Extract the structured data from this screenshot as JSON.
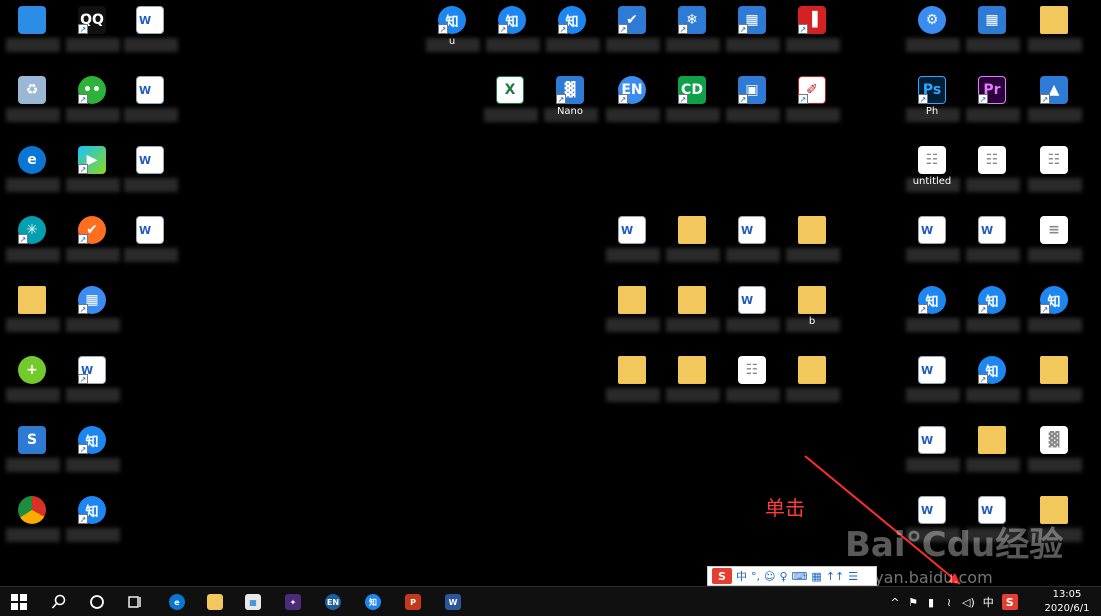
{
  "annotation": {
    "text": "单击"
  },
  "watermark": {
    "brand": "Bai℃du经验",
    "url": "jingyan.baidu.com"
  },
  "icons": [
    {
      "label": "",
      "kind": "computer",
      "glyph": "",
      "shortcut": false
    },
    {
      "label": "",
      "kind": "qq",
      "glyph": "QQ",
      "shortcut": true
    },
    {
      "label": "",
      "kind": "word",
      "glyph": "W",
      "shortcut": false
    },
    {
      "label": "",
      "kind": "recycle",
      "glyph": "♻",
      "shortcut": false
    },
    {
      "label": "",
      "kind": "wechat",
      "glyph": "••",
      "shortcut": true
    },
    {
      "label": "",
      "kind": "word",
      "glyph": "W",
      "shortcut": false
    },
    {
      "label": "",
      "kind": "edge",
      "glyph": "e",
      "shortcut": false
    },
    {
      "label": "",
      "kind": "video",
      "glyph": "▶",
      "shortcut": true
    },
    {
      "label": "",
      "kind": "word",
      "glyph": "W",
      "shortcut": false
    },
    {
      "label": "",
      "kind": "teal",
      "glyph": "✳",
      "shortcut": true
    },
    {
      "label": "",
      "kind": "orange",
      "glyph": "✔",
      "shortcut": true
    },
    {
      "label": "",
      "kind": "word",
      "glyph": "W",
      "shortcut": false
    },
    {
      "label": "",
      "kind": "folder",
      "glyph": "",
      "shortcut": false
    },
    {
      "label": "",
      "kind": "blue2",
      "glyph": "▦",
      "shortcut": true
    },
    {
      "label": "",
      "kind": "yellowgreen",
      "glyph": "+",
      "shortcut": false
    },
    {
      "label": "",
      "kind": "word",
      "glyph": "W",
      "shortcut": true
    },
    {
      "label": "",
      "kind": "generic",
      "glyph": "S",
      "shortcut": false
    },
    {
      "label": "",
      "kind": "zhi",
      "glyph": "知",
      "shortcut": true
    },
    {
      "label": "",
      "kind": "chrome",
      "glyph": "",
      "shortcut": false
    },
    {
      "label": "",
      "kind": "zhi",
      "glyph": "知",
      "shortcut": true
    },
    {
      "label": "u",
      "kind": "zhi",
      "glyph": "知",
      "shortcut": true
    },
    {
      "label": "",
      "kind": "zhi",
      "glyph": "知",
      "shortcut": true
    },
    {
      "label": "",
      "kind": "zhi",
      "glyph": "知",
      "shortcut": true
    },
    {
      "label": "",
      "kind": "generic",
      "glyph": "✔",
      "shortcut": true
    },
    {
      "label": "",
      "kind": "generic",
      "glyph": "❄",
      "shortcut": true
    },
    {
      "label": "",
      "kind": "generic",
      "glyph": "▦",
      "shortcut": true
    },
    {
      "label": "",
      "kind": "red",
      "glyph": "▐",
      "shortcut": true
    },
    {
      "label": "",
      "kind": "excel",
      "glyph": "X",
      "shortcut": false
    },
    {
      "label": "Nano",
      "kind": "generic",
      "glyph": "▓",
      "shortcut": true
    },
    {
      "label": "",
      "kind": "blue2",
      "glyph": "EN",
      "shortcut": true
    },
    {
      "label": "",
      "kind": "green",
      "glyph": "CD",
      "shortcut": true
    },
    {
      "label": "",
      "kind": "generic",
      "glyph": "▣",
      "shortcut": true
    },
    {
      "label": "",
      "kind": "pdf",
      "glyph": "✐",
      "shortcut": true
    },
    {
      "label": "",
      "kind": "blue2",
      "glyph": "⚙",
      "shortcut": false
    },
    {
      "label": "",
      "kind": "generic",
      "glyph": "▦",
      "shortcut": false
    },
    {
      "label": "",
      "kind": "folder",
      "glyph": "",
      "shortcut": false
    },
    {
      "label": "Ph",
      "kind": "ps",
      "glyph": "Ps",
      "shortcut": true
    },
    {
      "label": "",
      "kind": "pr",
      "glyph": "Pr",
      "shortcut": true
    },
    {
      "label": "",
      "kind": "generic",
      "glyph": "▲",
      "shortcut": true
    },
    {
      "label": "untitled",
      "kind": "doc",
      "glyph": "☷",
      "shortcut": false
    },
    {
      "label": "",
      "kind": "doc",
      "glyph": "☷",
      "shortcut": false
    },
    {
      "label": "",
      "kind": "doc",
      "glyph": "☷",
      "shortcut": false
    },
    {
      "label": "",
      "kind": "word",
      "glyph": "W",
      "shortcut": false
    },
    {
      "label": "",
      "kind": "word",
      "glyph": "W",
      "shortcut": false
    },
    {
      "label": "",
      "kind": "doc",
      "glyph": "≡",
      "shortcut": false
    },
    {
      "label": "",
      "kind": "zhi",
      "glyph": "知",
      "shortcut": true
    },
    {
      "label": "",
      "kind": "zhi",
      "glyph": "知",
      "shortcut": true
    },
    {
      "label": "",
      "kind": "zhi",
      "glyph": "知",
      "shortcut": true
    },
    {
      "label": "",
      "kind": "word",
      "glyph": "W",
      "shortcut": false
    },
    {
      "label": "",
      "kind": "zhi",
      "glyph": "知",
      "shortcut": true
    },
    {
      "label": "",
      "kind": "folder",
      "glyph": "",
      "shortcut": false
    },
    {
      "label": "",
      "kind": "word",
      "glyph": "W",
      "shortcut": false
    },
    {
      "label": "",
      "kind": "folder",
      "glyph": "",
      "shortcut": false
    },
    {
      "label": "",
      "kind": "doc",
      "glyph": "▓",
      "shortcut": false
    },
    {
      "label": "",
      "kind": "word",
      "glyph": "W",
      "shortcut": false
    },
    {
      "label": "",
      "kind": "word",
      "glyph": "W",
      "shortcut": false
    },
    {
      "label": "",
      "kind": "folder",
      "glyph": "",
      "shortcut": false
    },
    {
      "label": "",
      "kind": "word",
      "glyph": "W",
      "shortcut": false
    },
    {
      "label": "",
      "kind": "folder",
      "glyph": "",
      "shortcut": false
    },
    {
      "label": "",
      "kind": "word",
      "glyph": "W",
      "shortcut": false
    },
    {
      "label": "",
      "kind": "folder",
      "glyph": "",
      "shortcut": false
    },
    {
      "label": "",
      "kind": "folder",
      "glyph": "",
      "shortcut": false
    },
    {
      "label": "",
      "kind": "folder",
      "glyph": "",
      "shortcut": false
    },
    {
      "label": "",
      "kind": "word",
      "glyph": "W",
      "shortcut": false
    },
    {
      "label": "b",
      "kind": "folder",
      "glyph": "",
      "shortcut": false
    },
    {
      "label": "",
      "kind": "folder",
      "glyph": "",
      "shortcut": false
    },
    {
      "label": "",
      "kind": "folder",
      "glyph": "",
      "shortcut": false
    },
    {
      "label": "",
      "kind": "doc",
      "glyph": "☷",
      "shortcut": false
    },
    {
      "label": "",
      "kind": "folder",
      "glyph": "",
      "shortcut": false
    }
  ],
  "ime": {
    "logo": "S",
    "items": [
      "中",
      "°,",
      "☺",
      "♀",
      "⌨",
      "▦",
      "↑↑",
      "☰"
    ]
  },
  "taskbar": {
    "pinned": [
      {
        "name": "edge",
        "glyph": "e",
        "color": "#0a76d4"
      },
      {
        "name": "explorer",
        "glyph": "",
        "color": "#f2c75c"
      },
      {
        "name": "store",
        "glyph": "▦",
        "color": "#e8e8e8"
      },
      {
        "name": "app-purple",
        "glyph": "✦",
        "color": "#4b2c7a"
      },
      {
        "name": "en",
        "glyph": "EN",
        "color": "#1b5fa0"
      },
      {
        "name": "zhihu",
        "glyph": "知",
        "color": "#1e86f0"
      },
      {
        "name": "powerpoint",
        "glyph": "P",
        "color": "#c4391a"
      },
      {
        "name": "word",
        "glyph": "W",
        "color": "#2b579a"
      }
    ],
    "tray": [
      "^",
      "⚑",
      "▮",
      "≀",
      "◁)",
      "中"
    ],
    "sogou": "S",
    "clock": {
      "time": "13:05",
      "date": "2020/6/1"
    }
  }
}
